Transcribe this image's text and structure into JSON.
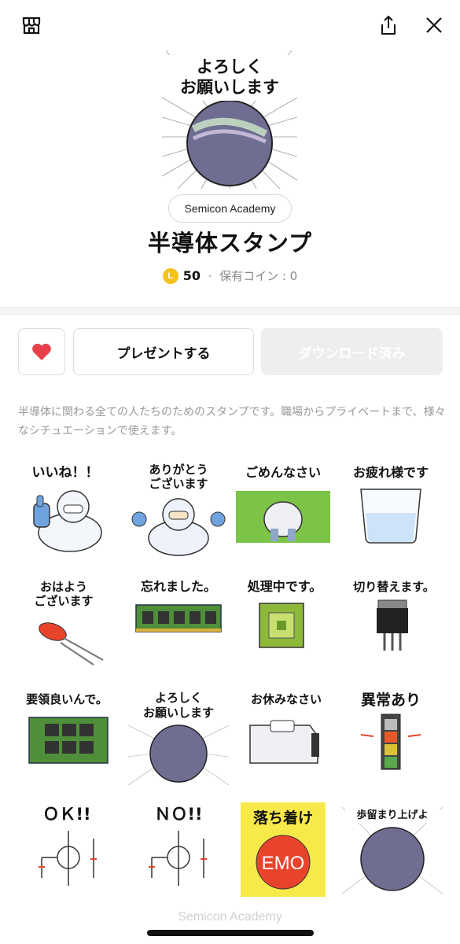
{
  "header": {
    "shop_icon": "shop-icon",
    "share_icon": "share-icon",
    "close_icon": "close-icon"
  },
  "sticker_set": {
    "main_caption_line1": "よろしく",
    "main_caption_line2": "お願いします",
    "author": "Semicon Academy",
    "title": "半導体スタンプ",
    "coin_symbol": "L",
    "price": "50",
    "separator": "・",
    "owned_coins": "保有コイン : 0"
  },
  "actions": {
    "like_icon": "heart-icon",
    "present_label": "プレゼントする",
    "download_label": "ダウンロード済み"
  },
  "description": "半導体に関わる全ての人たちのためのスタンプです。職場からプライベートまで、様々なシチュエーションで使えます。",
  "stickers": [
    {
      "caption": "いいね！！"
    },
    {
      "caption": "ありがとう",
      "caption2": "ございます"
    },
    {
      "caption": "ごめんなさい"
    },
    {
      "caption": "お疲れ様です"
    },
    {
      "caption": "おはよう",
      "caption2": "ございます"
    },
    {
      "caption": "忘れました。"
    },
    {
      "caption": "処理中です。"
    },
    {
      "caption": "切り替えます。"
    },
    {
      "caption": "要領良いんで。"
    },
    {
      "caption": "よろしく",
      "caption2": "お願いします"
    },
    {
      "caption": "お休みなさい"
    },
    {
      "caption": "異常あり"
    },
    {
      "caption": "ＯＫ!!"
    },
    {
      "caption": "ＮＯ!!"
    },
    {
      "caption": "落ち着け",
      "badge": "EMO"
    },
    {
      "caption": "歩留まり上げよ"
    }
  ],
  "footer": {
    "text": "Semicon Academy"
  },
  "colors": {
    "heart": "#e8404a",
    "coin": "#f4c21b",
    "description": "#999999",
    "disabled_button": "#eeeeee"
  }
}
